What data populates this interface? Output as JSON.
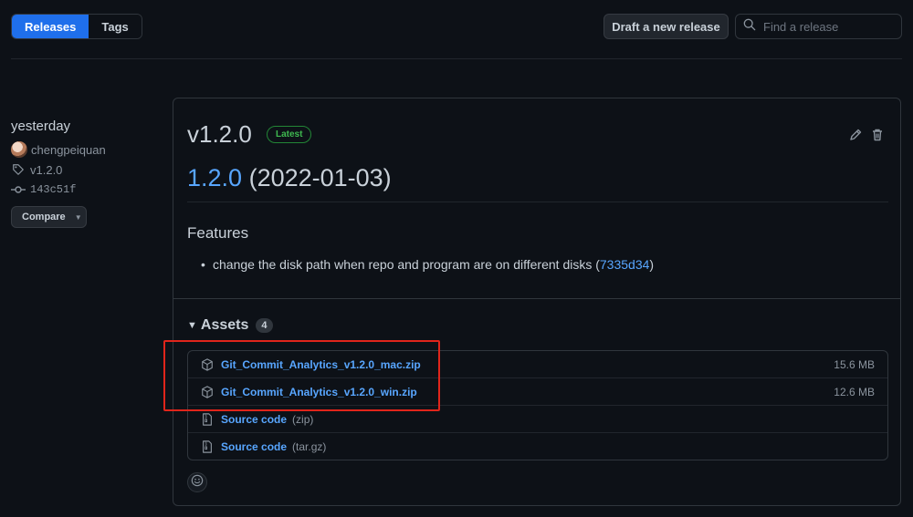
{
  "tabs": [
    {
      "label": "Releases",
      "active": true
    },
    {
      "label": "Tags",
      "active": false
    }
  ],
  "actions": {
    "draft_label": "Draft a new release",
    "search_placeholder": "Find a release"
  },
  "sidebar": {
    "time": "yesterday",
    "author": "chengpeiquan",
    "tag": "v1.2.0",
    "commit": "143c51f",
    "compare_label": "Compare"
  },
  "release": {
    "title": "v1.2.0",
    "badge": "Latest",
    "version_link": "1.2.0",
    "version_date": "(2022-01-03)",
    "features_heading": "Features",
    "features": [
      {
        "text": "change the disk path when repo and program are on different disks (",
        "link": "7335d34",
        "suffix": ")"
      }
    ]
  },
  "assets": {
    "heading": "Assets",
    "count": "4",
    "items": [
      {
        "name": "Git_Commit_Analytics_v1.2.0_mac.zip",
        "ext": "",
        "size": "15.6 MB",
        "icon": "package-icon"
      },
      {
        "name": "Git_Commit_Analytics_v1.2.0_win.zip",
        "ext": "",
        "size": "12.6 MB",
        "icon": "package-icon"
      },
      {
        "name": "Source code",
        "ext": "(zip)",
        "size": "",
        "icon": "file-zip-icon"
      },
      {
        "name": "Source code",
        "ext": "(tar.gz)",
        "size": "",
        "icon": "file-zip-icon"
      }
    ]
  },
  "colors": {
    "accent": "#1f6feb",
    "link": "#58a6ff",
    "latest_green": "#3fb950",
    "highlight_red": "#e0251b"
  }
}
